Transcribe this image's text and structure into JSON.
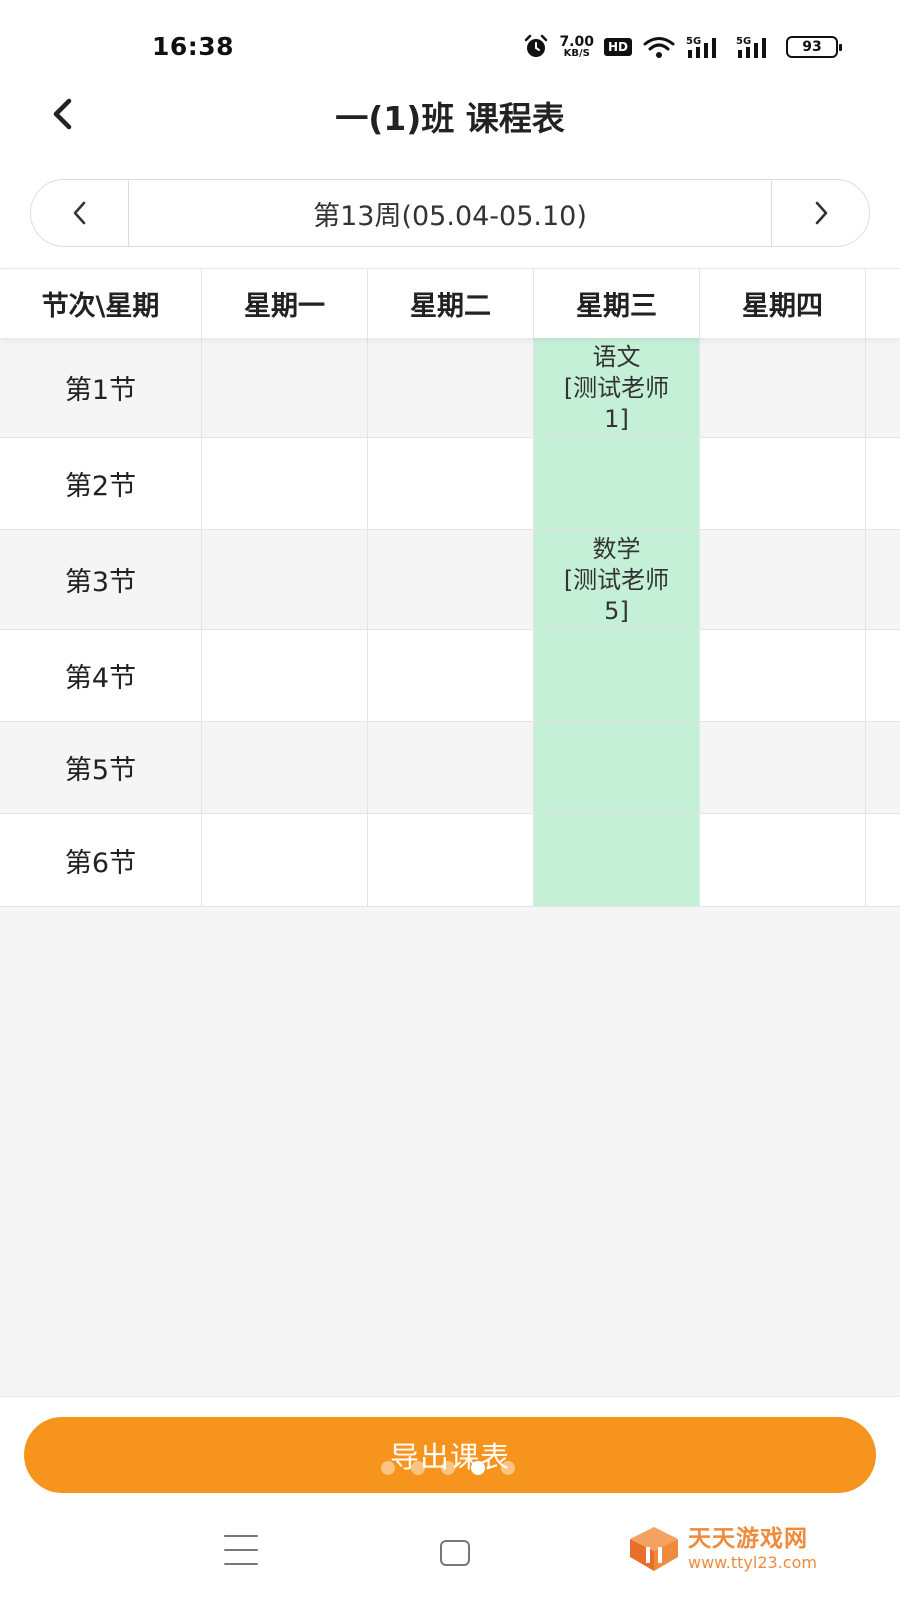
{
  "status_bar": {
    "time": "16:38",
    "net_speed_value": "7.00",
    "net_speed_unit": "KB/S",
    "hd_label": "HD",
    "signal_1_label": "5G",
    "signal_2_label": "5G",
    "battery": "93",
    "icons": [
      "alarm-icon",
      "wifi-icon",
      "signal-icon",
      "battery-icon"
    ]
  },
  "header": {
    "title": "一(1)班 课程表",
    "back_icon": "chevron-left-icon"
  },
  "week_selector": {
    "label": "第13周(05.04-05.10)",
    "prev_icon": "chevron-left-icon",
    "next_icon": "chevron-right-icon"
  },
  "timetable": {
    "corner_header": "节次\\星期",
    "days": [
      "星期一",
      "星期二",
      "星期三",
      "星期四"
    ],
    "highlight_day": "星期三",
    "highlight_color": "#c5f0d8",
    "periods": [
      {
        "label": "第1节",
        "cells": [
          "",
          "",
          "语文\n[测试老师\n1]",
          ""
        ]
      },
      {
        "label": "第2节",
        "cells": [
          "",
          "",
          "",
          ""
        ]
      },
      {
        "label": "第3节",
        "cells": [
          "",
          "",
          "数学\n[测试老师\n5]",
          ""
        ]
      },
      {
        "label": "第4节",
        "cells": [
          "",
          "",
          "",
          ""
        ]
      },
      {
        "label": "第5节",
        "cells": [
          "",
          "",
          "",
          ""
        ]
      },
      {
        "label": "第6节",
        "cells": [
          "",
          "",
          "",
          ""
        ]
      }
    ]
  },
  "footer": {
    "export_button": "导出课表",
    "accent_color": "#f7941e",
    "carousel_dots": 5,
    "carousel_active_index": 3
  },
  "watermark": {
    "title": "天天游戏网",
    "url": "www.ttyl23.com"
  }
}
